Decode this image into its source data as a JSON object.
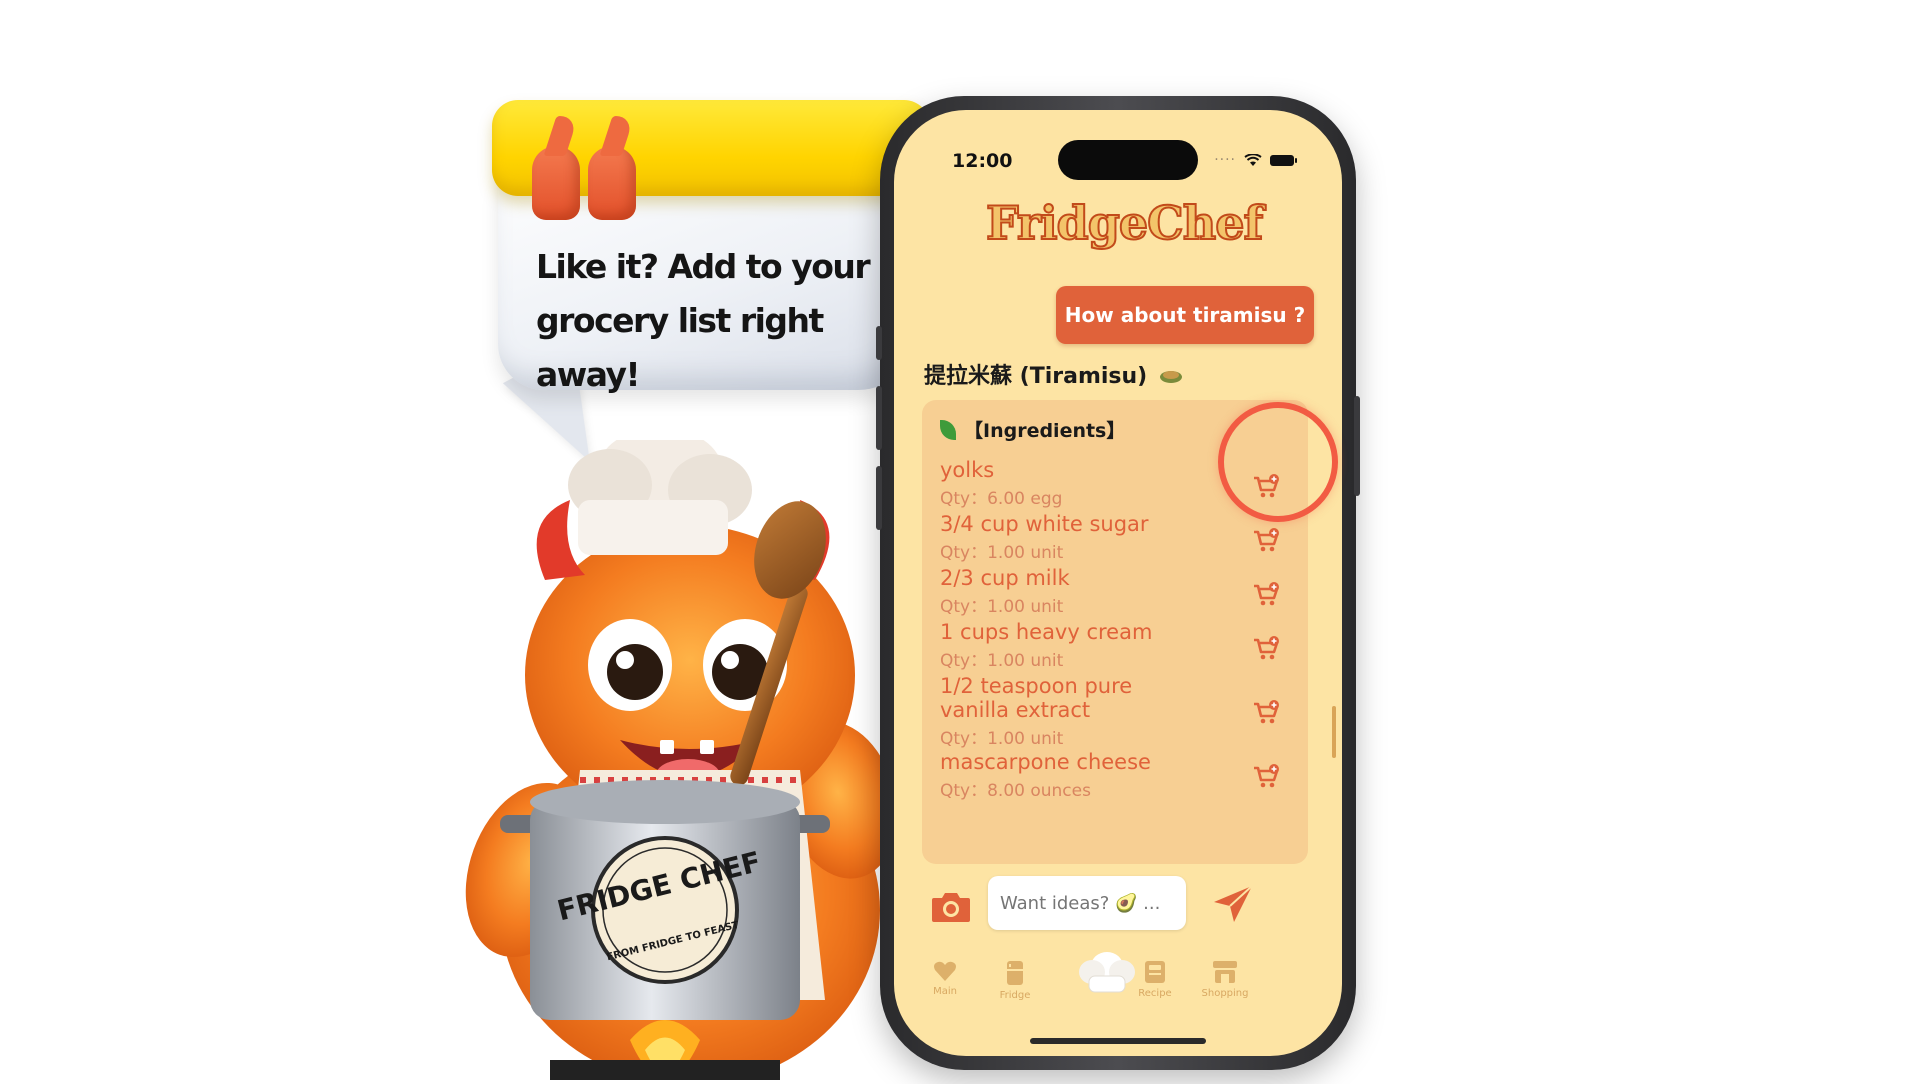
{
  "promo": {
    "bubble_text": "Like it? Add to your grocery list right away!"
  },
  "mascot": {
    "pot_badge": "FRIDGE CHEF",
    "pot_badge_sub": "FROM FRIDGE TO FEAST"
  },
  "phone": {
    "status": {
      "time": "12:00"
    },
    "app_name": "FridgeChef",
    "suggestion_button": "How about tiramisu ?",
    "recipe_title": "提拉米蘇 (Tiramisu)",
    "ingredients_heading": "【Ingredients】",
    "ingredients": [
      {
        "name": "yolks",
        "qty": "Qty：6.00 egg"
      },
      {
        "name": "3/4 cup white sugar",
        "qty": "Qty：1.00 unit"
      },
      {
        "name": "2/3 cup milk",
        "qty": "Qty：1.00 unit"
      },
      {
        "name": "1 cups heavy cream",
        "qty": "Qty：1.00 unit"
      },
      {
        "name": "1/2 teaspoon pure vanilla extract",
        "qty": "Qty：1.00 unit"
      },
      {
        "name": "mascarpone cheese",
        "qty": "Qty：8.00 ounces"
      }
    ],
    "chat_placeholder": "Want ideas? 🥑 ...",
    "tabs": [
      {
        "label": "Main",
        "icon": "heart-icon"
      },
      {
        "label": "Fridge",
        "icon": "fridge-icon"
      },
      {
        "label": "",
        "icon": "chef-hat-icon"
      },
      {
        "label": "Recipe",
        "icon": "recipe-book-icon"
      },
      {
        "label": "Shopping",
        "icon": "store-icon"
      }
    ]
  },
  "colors": {
    "accent": "#e0623a",
    "screen_bg": "#fde4a4",
    "card_bg": "#f7cf93",
    "highlight": "#f25b43"
  }
}
